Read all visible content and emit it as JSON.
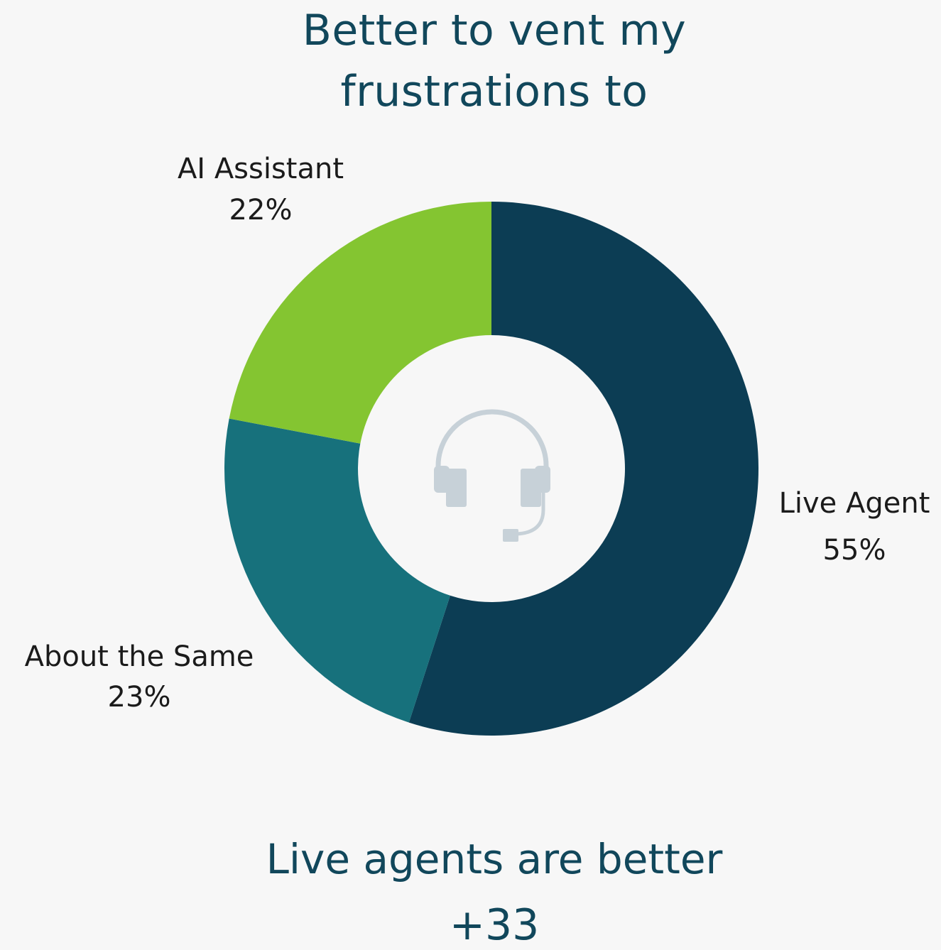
{
  "title_lines": [
    "Better to vent my",
    "frustrations to"
  ],
  "chart_data": {
    "type": "pie",
    "donut": true,
    "categories": [
      "Live Agent",
      "About the Same",
      "AI Assistant"
    ],
    "values": [
      55,
      23,
      22
    ],
    "value_labels": [
      "55%",
      "23%",
      "22%"
    ],
    "colors": [
      "#0c3d54",
      "#17717c",
      "#84c531"
    ],
    "center_icon": "headset-icon",
    "center_icon_color": "#c7d1d8",
    "label_color": "#1b1b1b"
  },
  "summary": {
    "text": "Live agents are better",
    "delta": "+33"
  }
}
